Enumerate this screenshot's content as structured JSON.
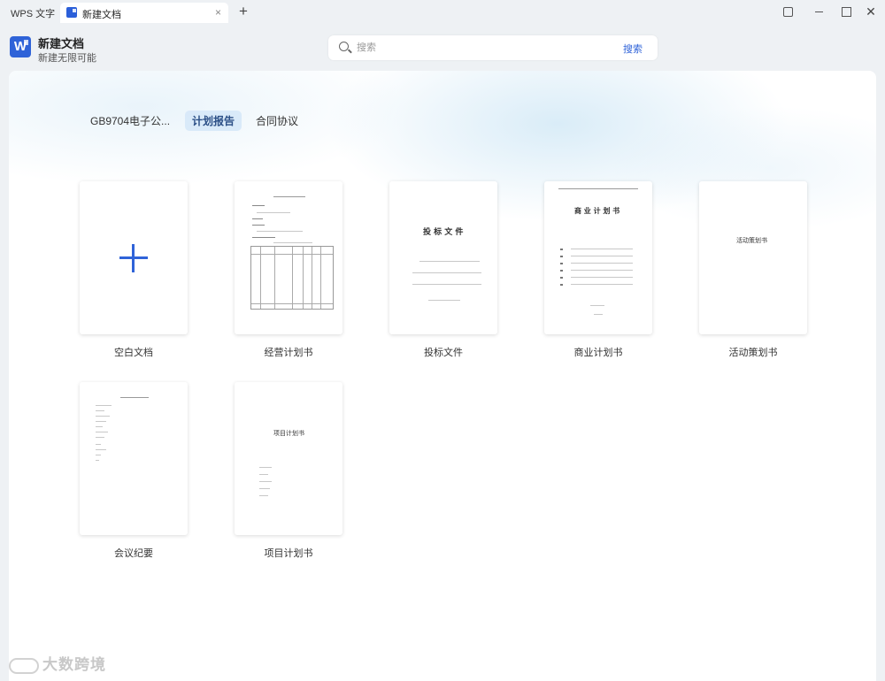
{
  "titlebar": {
    "app_name": "WPS 文字",
    "tab_title": "新建文档",
    "tab_close": "×",
    "tab_add": "+",
    "close": "✕"
  },
  "header": {
    "logo_letter": "W",
    "title": "新建文档",
    "subtitle": "新建无限可能"
  },
  "search": {
    "placeholder": "搜索",
    "button": "搜索"
  },
  "categories": [
    "GB9704电子公...",
    "计划报告",
    "合同协议"
  ],
  "active_category": "计划报告",
  "templates": [
    {
      "label": "空白文档"
    },
    {
      "label": "经营计划书"
    },
    {
      "label": "投标文件",
      "thumb_title": "投 标 文 件"
    },
    {
      "label": "商业计划书",
      "thumb_title": "商 业 计 划 书"
    },
    {
      "label": "活动策划书",
      "thumb_title": "活动策划书"
    },
    {
      "label": "会议纪要"
    },
    {
      "label": "项目计划书",
      "thumb_title": "项目计划书"
    }
  ],
  "watermark": "大数跨境"
}
